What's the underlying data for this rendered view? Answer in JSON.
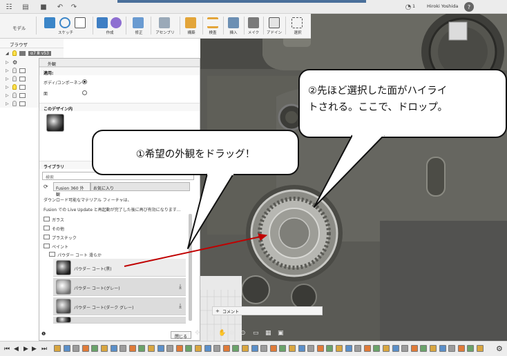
{
  "topbar": {
    "user_name": "Hiroki Yoshida",
    "notification_count": "1",
    "help": "?"
  },
  "ribbon": {
    "workspace": "モデル",
    "groups": [
      "スケッチ",
      "作成",
      "修正",
      "アセンブリ",
      "構築",
      "検査",
      "挿入",
      "メイク",
      "アドイン",
      "選択"
    ]
  },
  "browser": {
    "header": "ブラウザ",
    "root_item": "α7 Ⅲ v53",
    "items": [
      "",
      "",
      "",
      "",
      "",
      ""
    ]
  },
  "panel": {
    "title": "外観",
    "applies_to_header": "適用:",
    "option_body": "ボディ/コンポーネント",
    "option_face": "面",
    "in_design_header": "このデザイン内",
    "library_header": "ライブラリ",
    "search_placeholder": "検索",
    "tab_fusion": "Fusion 360 外観",
    "tab_favorites": "お気に入り",
    "notice_1": "ダウンロード可能なマテリアル フィーチャは、",
    "notice_2": "Fusion での Live Update と再起動が完了した後に再び有効になります...",
    "folders": [
      "ガラス",
      "その他",
      "プラスチック",
      "ペイント"
    ],
    "subfolder": "パウダー コート 滑らか",
    "materials": [
      "パウダー コート(黒)",
      "パウダー コート(グレー)",
      "パウダー コート(ダーク グレー)"
    ],
    "close_button": "閉じる"
  },
  "callouts": {
    "step1": "①希望の外観をドラッグ！",
    "step2_line1": "②先ほど選択した面がハイライ",
    "step2_line2": "トされる。ここで、ドロップ。"
  },
  "comments": {
    "label": "コメント"
  },
  "colors": {
    "callout_arrow": "#c00000",
    "viewport_bg": "#5b5b55",
    "accent": "#4a6f9a"
  }
}
